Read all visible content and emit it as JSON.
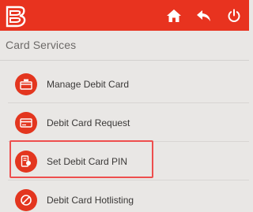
{
  "header": {
    "logo_icon": "bank-logo-icon",
    "home_icon": "home-icon",
    "back_icon": "back-arrow-icon",
    "power_icon": "power-icon",
    "background_color": "#e8331f"
  },
  "section": {
    "title": "Card Services"
  },
  "items": [
    {
      "label": "Manage Debit Card",
      "icon": "card-settings-icon"
    },
    {
      "label": "Debit Card Request",
      "icon": "card-icon"
    },
    {
      "label": "Set Debit Card PIN",
      "icon": "card-pin-icon",
      "highlighted": true
    },
    {
      "label": "Debit Card Hotlisting",
      "icon": "block-icon"
    }
  ],
  "colors": {
    "accent": "#e3361f",
    "highlight_border": "#ee4e4e"
  }
}
